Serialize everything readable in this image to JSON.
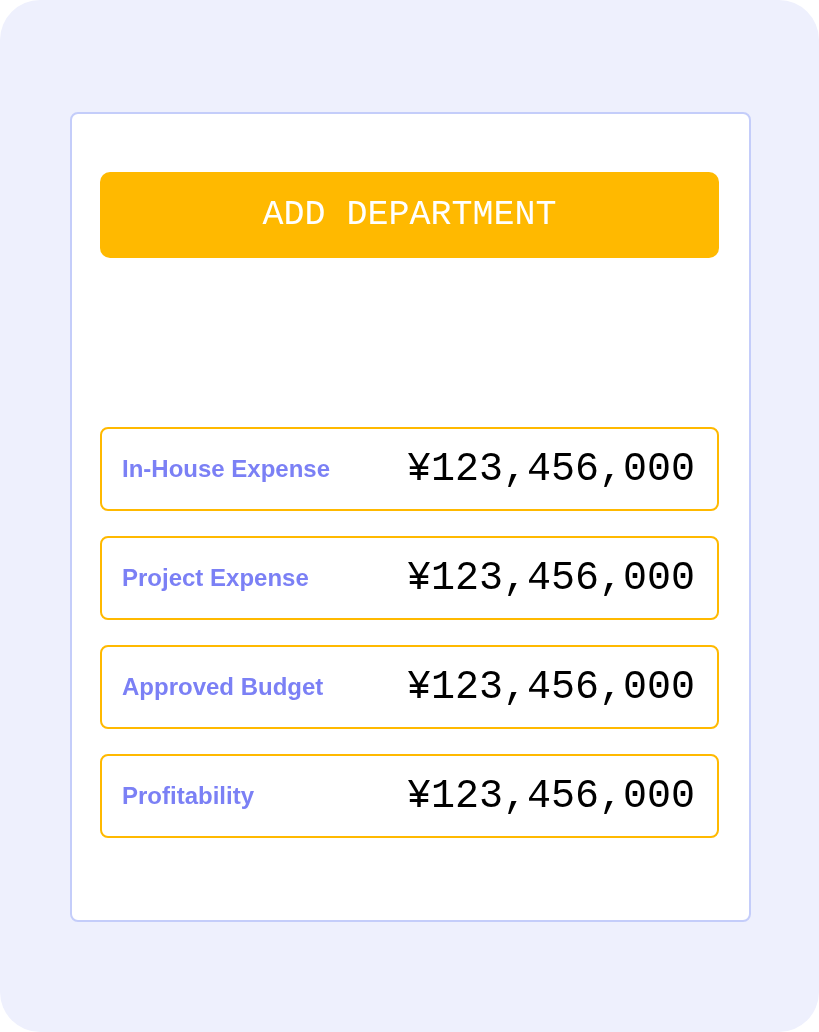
{
  "button": {
    "label": "ADD DEPARTMENT"
  },
  "summary": [
    {
      "label": "In-House Expense",
      "value": "¥123,456,000"
    },
    {
      "label": "Project Expense",
      "value": "¥123,456,000"
    },
    {
      "label": "Approved Budget",
      "value": "¥123,456,000"
    },
    {
      "label": "Profitability",
      "value": "¥123,456,000"
    }
  ]
}
